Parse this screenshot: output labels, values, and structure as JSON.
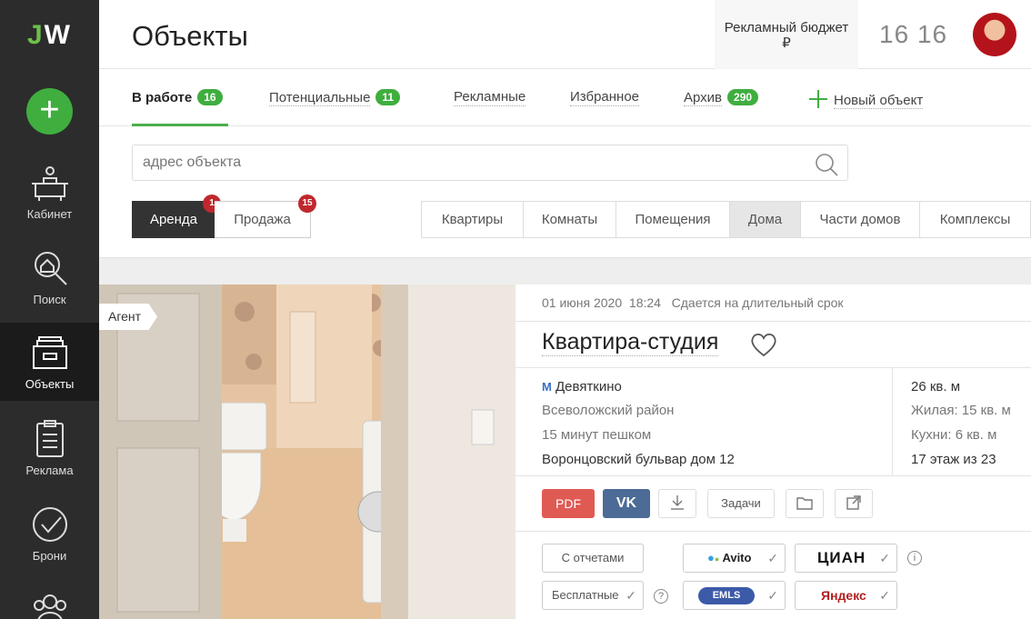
{
  "logo": {
    "j": "J",
    "w": "W"
  },
  "sidebar": {
    "add_label": "+",
    "items": [
      {
        "label": "Кабинет",
        "icon": "cabinet-icon"
      },
      {
        "label": "Поиск",
        "icon": "search-house-icon"
      },
      {
        "label": "Объекты",
        "icon": "objects-icon",
        "active": true
      },
      {
        "label": "Реклама",
        "icon": "clipboard-icon"
      },
      {
        "label": "Брони",
        "icon": "check-circle-icon"
      },
      {
        "label": "",
        "icon": "people-icon"
      }
    ]
  },
  "header": {
    "title": "Объекты",
    "budget_label": "Рекламный бюджет",
    "budget_currency": "₽",
    "counter_a": "16",
    "counter_b": "16"
  },
  "tabs": [
    {
      "label": "В работе",
      "count": "16"
    },
    {
      "label": "Потенциальные",
      "count": "11"
    },
    {
      "label": "Рекламные",
      "count": ""
    },
    {
      "label": "Избранное",
      "count": ""
    },
    {
      "label": "Архив",
      "count": "290"
    },
    {
      "label": "Новый объект",
      "count": ""
    }
  ],
  "search": {
    "placeholder": "адрес объекта"
  },
  "deal_types": [
    {
      "label": "Аренда",
      "badge": "1"
    },
    {
      "label": "Продажа",
      "badge": "15"
    }
  ],
  "property_types": [
    "Квартиры",
    "Комнаты",
    "Помещения",
    "Дома",
    "Части домов",
    "Комплексы"
  ],
  "property_type_selected": "Дома",
  "listing": {
    "agent_tag": "Агент",
    "date": "01 июня 2020",
    "time": "18:24",
    "status": "Сдается на длительный срок",
    "title": "Квартира-студия",
    "metro_symbol": "M",
    "metro": "Девяткино",
    "district": "Всеволожский район",
    "walk": "15 минут пешком",
    "address": "Воронцовский бульвар дом 12",
    "area": "26 кв. м",
    "living": "Жилая: 15 кв. м",
    "kitchen": "Кухни: 6 кв. м",
    "floor": "17 этаж из 23"
  },
  "actions": {
    "pdf": "PDF",
    "vk": "VK",
    "tasks": "Задачи"
  },
  "options": {
    "reports": "С отчетами",
    "free": "Бесплатные",
    "avito": "Avito",
    "cian": "ЦИАН",
    "emls": "EMLS",
    "yandex": "Яндекс",
    "info": "i",
    "help": "?",
    "check": "✓"
  },
  "colors": {
    "accent": "#3fae3f",
    "sidebar": "#2c2c2c",
    "pdf": "#e05a54",
    "vk": "#4c6b96",
    "alert": "#c0282d"
  }
}
